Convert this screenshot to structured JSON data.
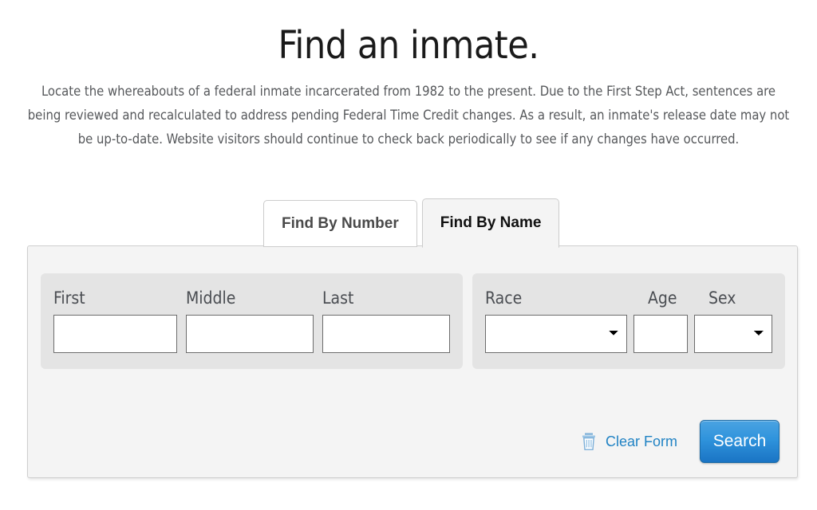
{
  "header": {
    "title": "Find an inmate.",
    "description": "Locate the whereabouts of a federal inmate incarcerated from 1982 to the present. Due to the First Step Act, sentences are being reviewed and recalculated to address pending Federal Time Credit changes. As a result, an inmate's release date may not be up-to-date. Website visitors should continue to check back periodically to see if any changes have occurred."
  },
  "tabs": [
    {
      "label": "Find By Number",
      "active": false
    },
    {
      "label": "Find By Name",
      "active": true
    }
  ],
  "form": {
    "name_group": {
      "fields": [
        {
          "label": "First",
          "value": "",
          "placeholder": "",
          "type": "text"
        },
        {
          "label": "Middle",
          "value": "",
          "placeholder": "",
          "type": "text"
        },
        {
          "label": "Last",
          "value": "",
          "placeholder": "",
          "type": "text"
        }
      ]
    },
    "demographics_group": {
      "fields": [
        {
          "label": "Race",
          "value": "",
          "type": "select",
          "options": [
            ""
          ]
        },
        {
          "label": "Age",
          "value": "",
          "placeholder": "",
          "type": "text"
        },
        {
          "label": "Sex",
          "value": "",
          "type": "select",
          "options": [
            ""
          ]
        }
      ]
    }
  },
  "actions": {
    "clear_form_label": "Clear Form",
    "search_label": "Search"
  },
  "colors": {
    "title": "#1a1a1a",
    "body_text": "#56585b",
    "link_blue": "#2183c4",
    "button_blue": "#2f93dc",
    "panel_bg": "#f4f4f4",
    "fieldset_bg": "#e4e4e4",
    "border": "#cfcfcf"
  }
}
